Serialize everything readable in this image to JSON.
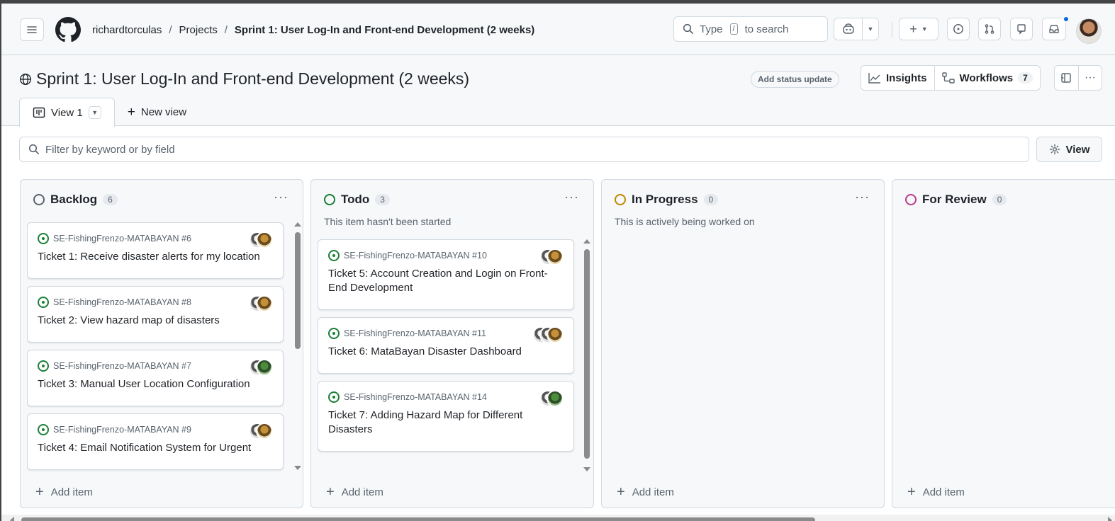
{
  "header": {
    "breadcrumbs": [
      "richardtorculas",
      "Projects",
      "Sprint 1: User Log-In and Front-end Development (2 weeks)"
    ],
    "search": {
      "prefix": "Type",
      "key": "/",
      "suffix": "to search"
    },
    "icons": [
      "menu-icon",
      "github-logo-icon",
      "copilot-icon",
      "plus-icon",
      "issues-icon",
      "pull-requests-icon",
      "discussions-icon",
      "inbox-icon"
    ]
  },
  "project": {
    "title": "Sprint 1: User Log-In and Front-end Development (2 weeks)",
    "status_update": "Add status update",
    "insights": "Insights",
    "workflows": "Workflows",
    "workflows_count": "7"
  },
  "tabs": {
    "view1": "View 1",
    "new_view": "New view"
  },
  "filter": {
    "placeholder": "Filter by keyword or by field",
    "view_button": "View"
  },
  "add_item_label": "Add item",
  "columns": [
    {
      "name": "Backlog",
      "count": "6",
      "description": "",
      "color": "#59636e",
      "cards": [
        {
          "repo": "SE-FishingFrenzo-MATABAYAN #6",
          "title": "Ticket 1: Receive disaster alerts for my location"
        },
        {
          "repo": "SE-FishingFrenzo-MATABAYAN #8",
          "title": "Ticket 2: View hazard map of disasters"
        },
        {
          "repo": "SE-FishingFrenzo-MATABAYAN #7",
          "title": "Ticket 3: Manual User Location Configuration"
        },
        {
          "repo": "SE-FishingFrenzo-MATABAYAN #9",
          "title": "Ticket 4: Email Notification System for Urgent"
        }
      ]
    },
    {
      "name": "Todo",
      "count": "3",
      "description": "This item hasn't been started",
      "color": "#1a7f37",
      "cards": [
        {
          "repo": "SE-FishingFrenzo-MATABAYAN #10",
          "title": "Ticket 5: Account Creation and Login on Front-End Development"
        },
        {
          "repo": "SE-FishingFrenzo-MATABAYAN #11",
          "title": "Ticket 6: MataBayan Disaster Dashboard"
        },
        {
          "repo": "SE-FishingFrenzo-MATABAYAN #14",
          "title": "Ticket 7: Adding Hazard Map for Different Disasters"
        }
      ]
    },
    {
      "name": "In Progress",
      "count": "0",
      "description": "This is actively being worked on",
      "color": "#bf8700",
      "cards": []
    },
    {
      "name": "For Review",
      "count": "0",
      "description": "",
      "color": "#bf3989",
      "cards": []
    }
  ]
}
